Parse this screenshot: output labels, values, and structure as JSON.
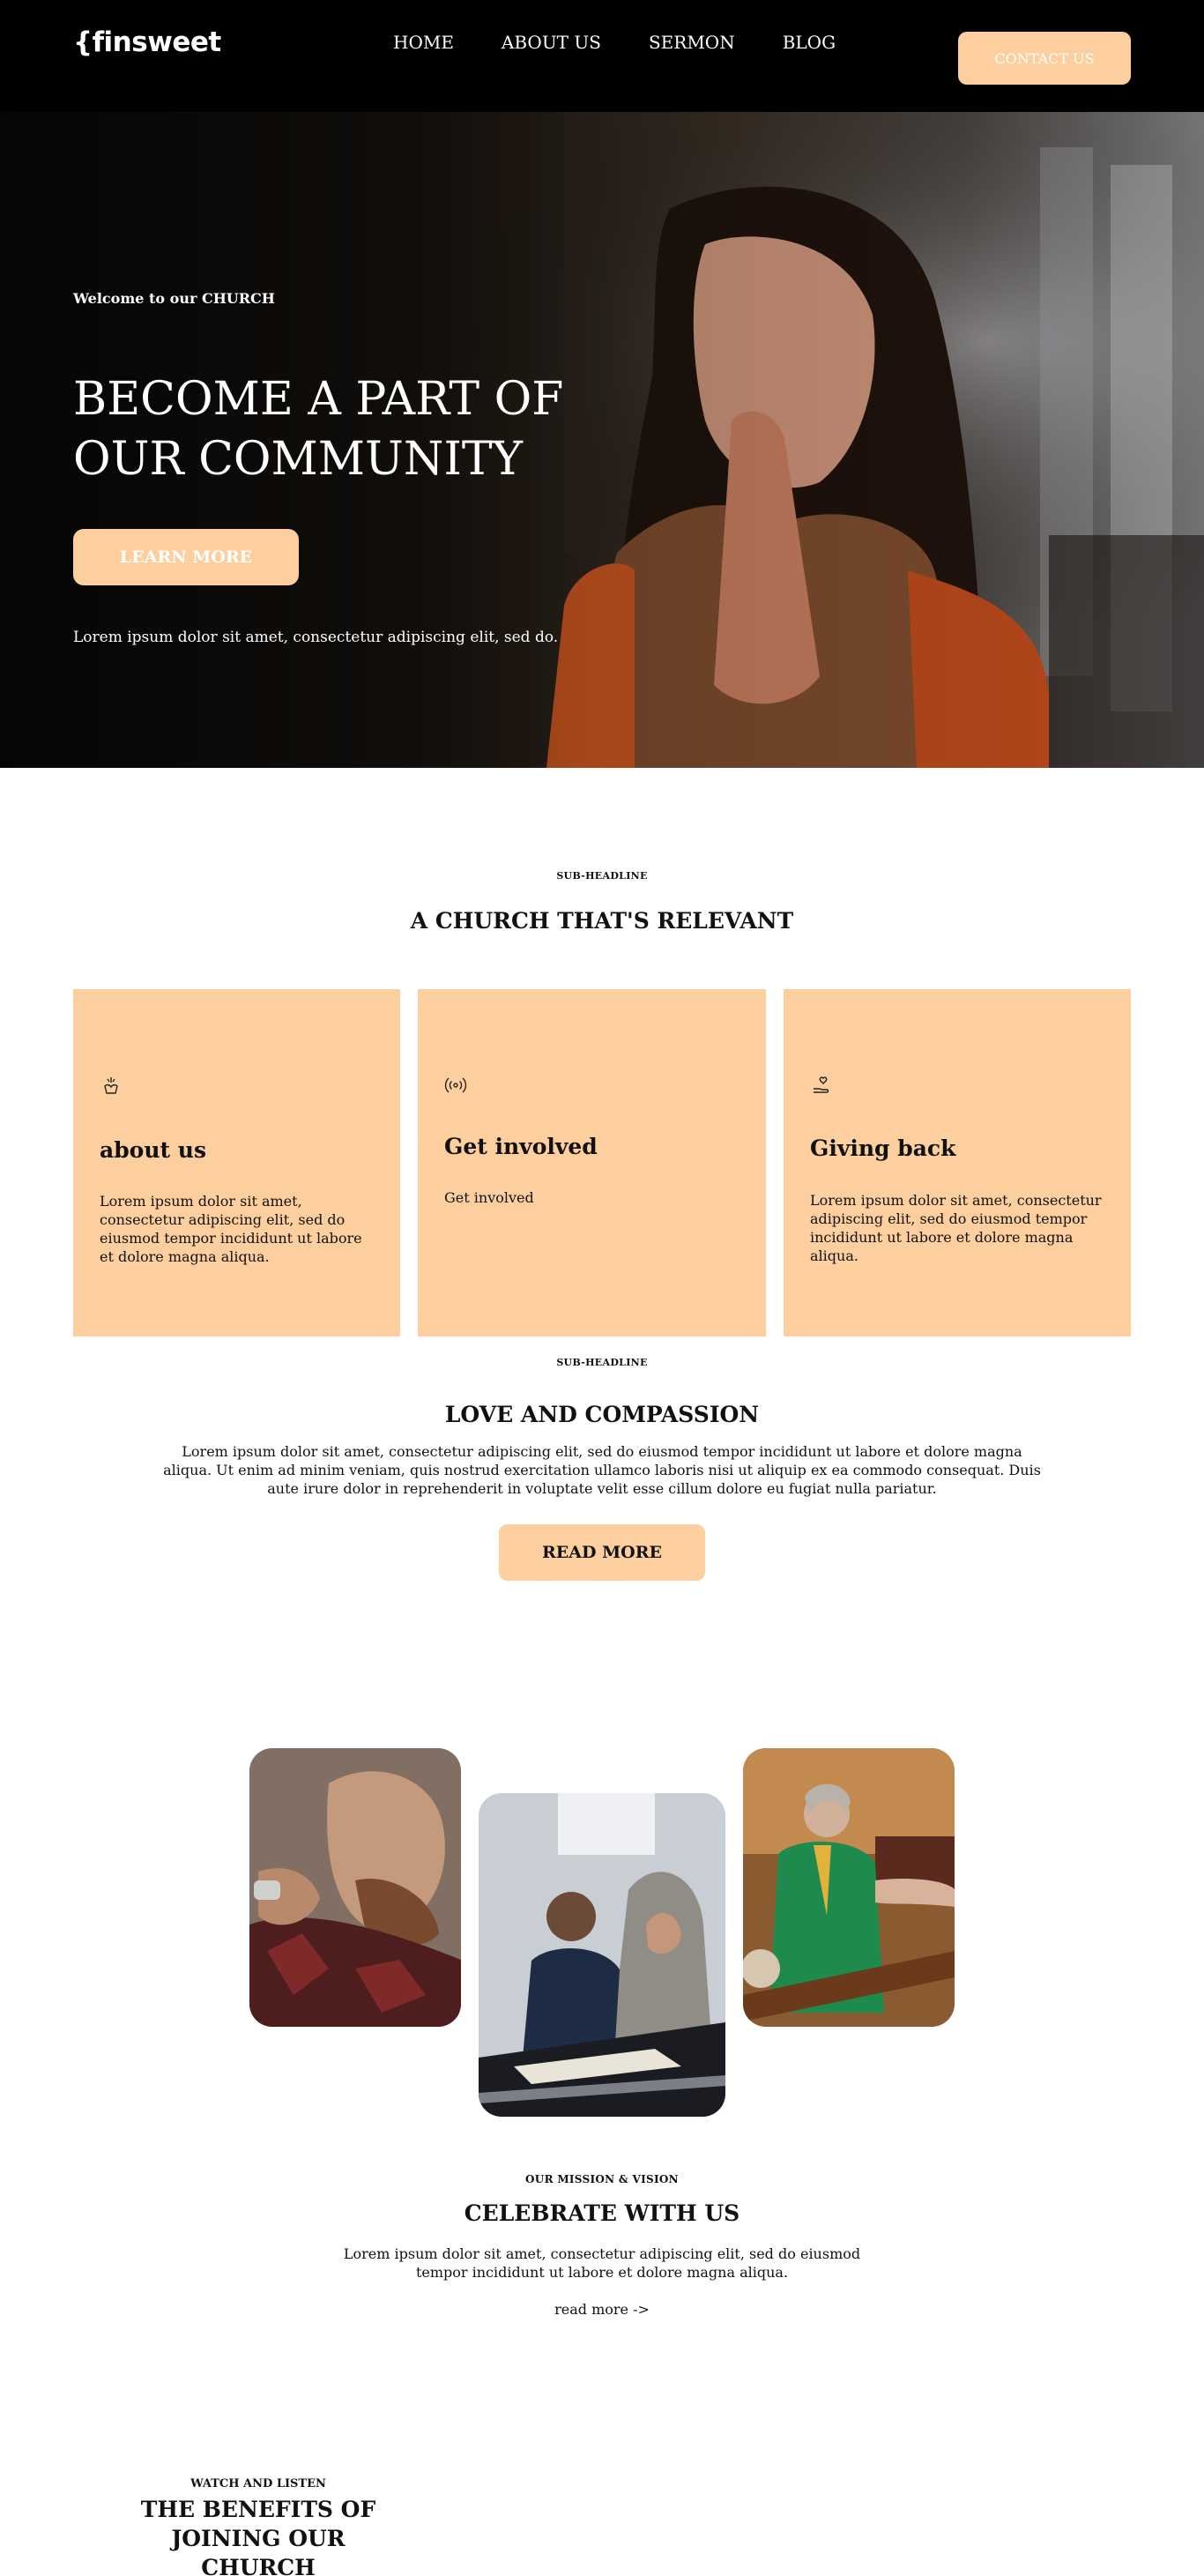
{
  "nav": {
    "logo": "{finsweet",
    "links": [
      {
        "label": "HOME"
      },
      {
        "label": "ABOUT US"
      },
      {
        "label": "SERMON"
      },
      {
        "label": "BLOG"
      }
    ],
    "contact_label": "CONTACT US"
  },
  "hero": {
    "eyebrow": "Welcome to our CHURCH",
    "title_line1": "BECOME A PART OF",
    "title_line2": "OUR COMMUNITY",
    "button_label": "LEARN MORE",
    "text": "Lorem ipsum dolor sit amet, consectetur adipiscing elit, sed do."
  },
  "relevant": {
    "sub": "SUB-HEADLINE",
    "title": "A CHURCH THAT'S RELEVANT",
    "cards": [
      {
        "icon": "praying-hands-icon",
        "title": "about us",
        "text": "Lorem ipsum dolor sit amet, consectetur adipiscing elit, sed do eiusmod tempor incididunt ut labore et dolore magna aliqua."
      },
      {
        "icon": "broadcast-icon",
        "title": "Get involved",
        "text": "Get involved"
      },
      {
        "icon": "heart-hand-icon",
        "title": "Giving back",
        "text": "Lorem ipsum dolor sit amet, consectetur adipiscing elit, sed do eiusmod tempor incididunt ut labore et dolore magna aliqua."
      }
    ]
  },
  "love": {
    "sub": "SUB-HEADLINE",
    "title": "LOVE AND COMPASSION",
    "text": "Lorem ipsum dolor sit amet, consectetur adipiscing elit, sed do eiusmod tempor incididunt ut labore et dolore magna aliqua. Ut enim ad minim veniam, quis nostrud exercitation ullamco laboris nisi ut aliquip ex ea commodo consequat. Duis aute irure dolor in reprehenderit in voluptate velit esse cillum dolore eu fugiat nulla pariatur.",
    "button_label": "READ MORE"
  },
  "mission": {
    "sub": "OUR MISSION & VISION",
    "title": "CELEBRATE WITH US",
    "text": "Lorem ipsum dolor sit amet, consectetur adipiscing elit, sed do eiusmod tempor incididunt ut labore et dolore magna aliqua.",
    "link": "read more ->"
  },
  "benefits": {
    "sub": "WATCH AND LISTEN",
    "title_line1": "THE BENEFITS OF",
    "title_line2": "JOINING OUR CHURCH"
  },
  "colors": {
    "accent": "#fdcf9e",
    "nav_bg": "#000000"
  }
}
